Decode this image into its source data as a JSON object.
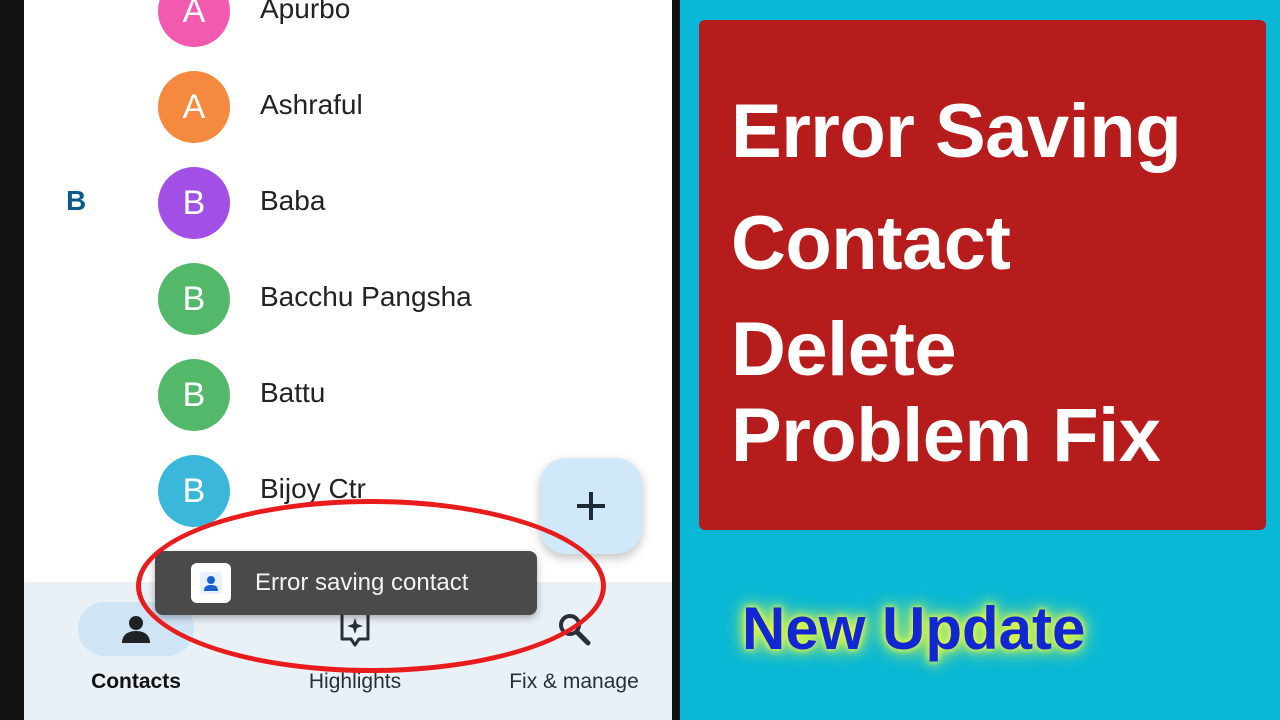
{
  "contacts": [
    {
      "section": "",
      "initial": "A",
      "name": "Apurbo",
      "color": "#f25ab0"
    },
    {
      "section": "",
      "initial": "A",
      "name": "Ashraful",
      "color": "#f4893f"
    },
    {
      "section": "B",
      "initial": "B",
      "name": "Baba",
      "color": "#a24fe6"
    },
    {
      "section": "",
      "initial": "B",
      "name": "Bacchu Pangsha",
      "color": "#54b86a"
    },
    {
      "section": "",
      "initial": "B",
      "name": "Battu",
      "color": "#54b86a"
    },
    {
      "section": "",
      "initial": "B",
      "name": "Bijoy Ctr",
      "color": "#3ab7db"
    }
  ],
  "fab": {
    "icon": "plus-icon",
    "label": "+"
  },
  "snackbar": {
    "icon": "contacts-app-icon",
    "text": "Error saving contact"
  },
  "nav": [
    {
      "icon": "person-icon",
      "label": "Contacts",
      "active": true
    },
    {
      "icon": "highlights-icon",
      "label": "Highlights",
      "active": false
    },
    {
      "icon": "search-icon",
      "label": "Fix & manage",
      "active": false
    }
  ],
  "title": {
    "lines": [
      "Error Saving",
      "Contact",
      "Delete",
      "Problem Fix"
    ],
    "background": "#b71c1c"
  },
  "subtitle": {
    "text": "New Update",
    "color": "#1226d4",
    "glow": "#f5ff3a"
  }
}
